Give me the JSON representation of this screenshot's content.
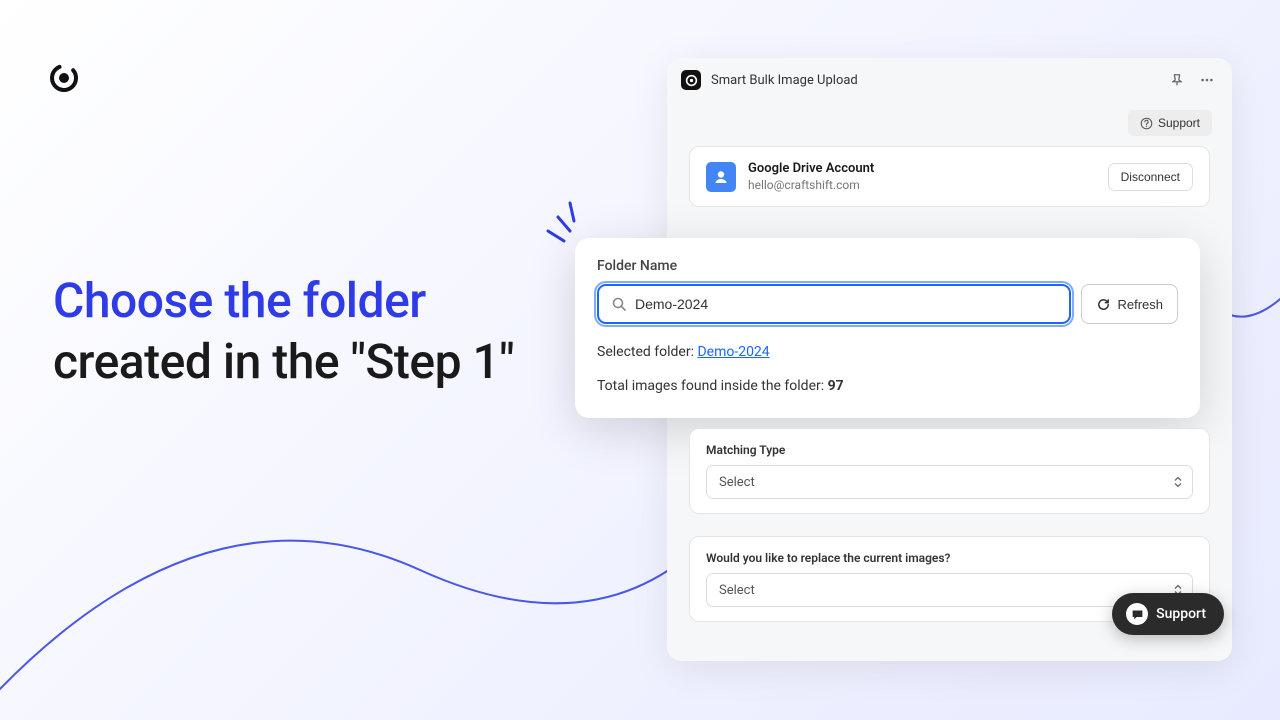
{
  "headline": {
    "blue": "Choose the folder",
    "rest1": "created in the",
    "rest2": "\"Step 1\""
  },
  "app": {
    "title": "Smart Bulk Image Upload",
    "support_label": "Support"
  },
  "account": {
    "title": "Google Drive Account",
    "email": "hello@craftshift.com",
    "disconnect_label": "Disconnect"
  },
  "folder": {
    "label": "Folder Name",
    "value": "Demo-2024",
    "refresh_label": "Refresh",
    "selected_prefix": "Selected folder: ",
    "selected_link": "Demo-2024",
    "total_prefix": "Total images found inside the folder: ",
    "total_count": "97"
  },
  "matching": {
    "label": "Matching Type",
    "select_placeholder": "Select"
  },
  "replace": {
    "label": "Would you like to replace the current images?",
    "select_placeholder": "Select"
  },
  "chat": {
    "label": "Support"
  }
}
